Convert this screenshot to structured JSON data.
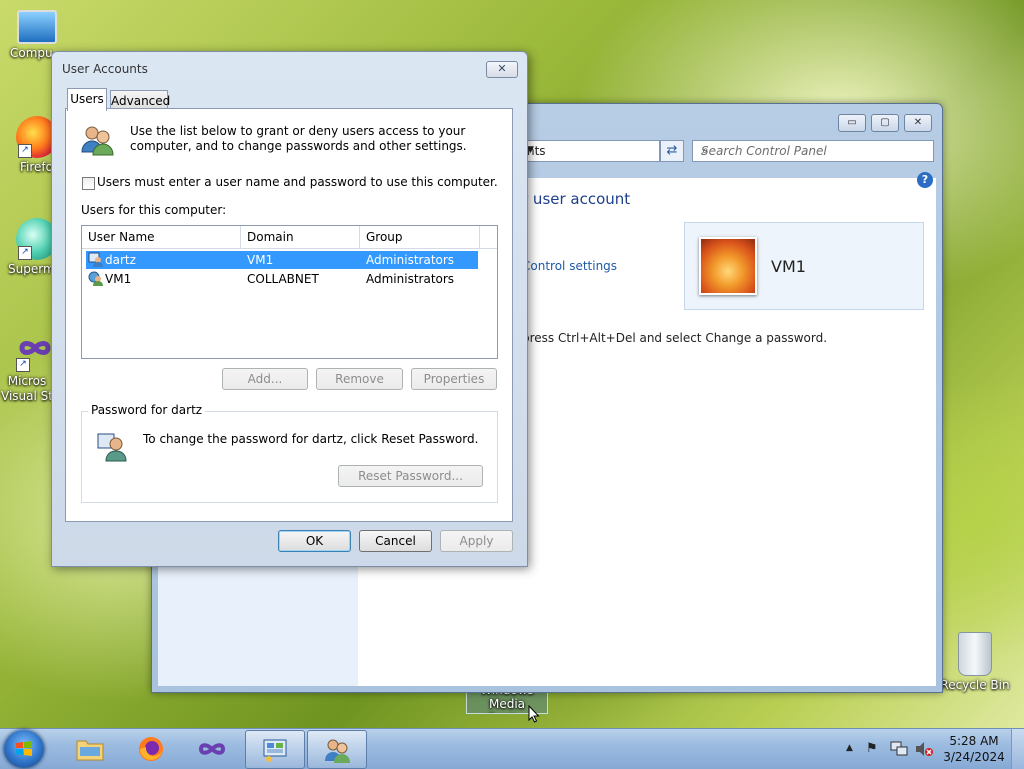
{
  "desktop": {
    "icons": [
      {
        "label": "Compu"
      },
      {
        "label": "Firefo"
      },
      {
        "label": "Superm"
      },
      {
        "label": "Micros Visual St"
      },
      {
        "label": "Recycle Bin"
      },
      {
        "label": "Windows Media Center"
      }
    ]
  },
  "control_panel": {
    "address_text": "nts",
    "search_placeholder": "Search Control Panel",
    "heading": "r user account",
    "link": "Control settings",
    "instruction": "press Ctrl+Alt+Del and select Change a password.",
    "account_name": "VM1",
    "buttons": {
      "minimize": "▭",
      "maximize": "▢",
      "close": "✕"
    }
  },
  "dialog": {
    "title": "User Accounts",
    "close_glyph": "✕",
    "tabs": [
      {
        "label": "Users"
      },
      {
        "label": "Advanced"
      }
    ],
    "intro": "Use the list below to grant or deny users access to your computer, and to change passwords and other settings.",
    "checkbox_label": "Users must enter a user name and password to use this computer.",
    "checkbox_checked": false,
    "users_label": "Users for this computer:",
    "columns": [
      "User Name",
      "Domain",
      "Group"
    ],
    "rows": [
      {
        "user": "dartz",
        "domain": "VM1",
        "group": "Administrators",
        "selected": true
      },
      {
        "user": "VM1",
        "domain": "COLLABNET",
        "group": "Administrators",
        "selected": false
      }
    ],
    "list_buttons": {
      "add": "Add...",
      "remove": "Remove",
      "properties": "Properties"
    },
    "password_group": {
      "legend": "Password for dartz",
      "text": "To change the password for dartz, click Reset Password.",
      "reset_button": "Reset Password..."
    },
    "footer_buttons": {
      "ok": "OK",
      "cancel": "Cancel",
      "apply": "Apply"
    }
  },
  "taskbar": {
    "items": [
      "start-orb",
      "windows-explorer",
      "firefox",
      "visual-studio",
      "control-panel",
      "user-accounts"
    ],
    "clock": {
      "time": "5:28 AM",
      "date": "3/24/2024"
    },
    "tray_icons": [
      "show-hidden-icon",
      "action-center-flag-icon",
      "network-icon",
      "volume-muted-icon"
    ]
  }
}
